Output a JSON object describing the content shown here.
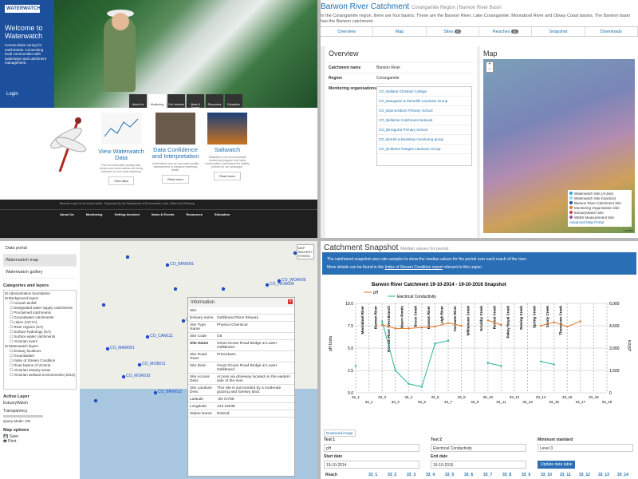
{
  "q1": {
    "logo": "WATERWATCH",
    "welcome": "Welcome to Waterwatch",
    "blurb": "Communities caring for catchments. Connecting local communities with waterways and catchment management.",
    "login": "Login",
    "nav": [
      "About Us",
      "Monitoring",
      "Get Involved",
      "News & Events",
      "Resources",
      "Education"
    ],
    "cards": [
      {
        "title": "View Waterwatch Data",
        "desc": "Find out what water quality data, photos and observations are being collected on your local waterway.",
        "btn": "View data"
      },
      {
        "title": "Data Confidence and Interpretation",
        "desc": "Understand how we use water quality assessments to measure waterway health.",
        "btn": "Read more"
      },
      {
        "title": "Saltwatch",
        "desc": "Saltwatch is an environmental monitoring program that helps communities understand the salinity problem in our landscape.",
        "btn": "Read more"
      }
    ],
    "footer_social": "Become a part of our social media",
    "footer_support": "Supported by the Department of Environment, Land, Water and Planning",
    "footer_cols": [
      "About Us",
      "Monitoring",
      "Getting Involved",
      "News & Events",
      "Resources",
      "Education"
    ]
  },
  "q2": {
    "title": "Barwon River Catchment",
    "subtitle": "Corangamite Region | Barwon River Basin",
    "desc": "In the Corangamite region, there are four basins. These are the Barwon River, Lake Corangamite, Moorabool River and Otway Coast basins. The Barwon basin has the Barwon catchment.",
    "tabs": [
      {
        "label": "Overview"
      },
      {
        "label": "Map"
      },
      {
        "label": "Sites",
        "badge": "93"
      },
      {
        "label": "Reaches",
        "badge": "36"
      },
      {
        "label": "Snapshot"
      },
      {
        "label": "Downloads"
      }
    ],
    "overview_heading": "Overview",
    "catchment_label": "Catchment name",
    "catchment_value": "Barwon River",
    "region_label": "Region",
    "region_value": "Corangamite",
    "orgs_label": "Monitoring organisations",
    "orgs": [
      "CO_Ballarat Christian College",
      "CO_Bamganie & Meredith Landcare Group",
      "CO_Bannockburn Primary School",
      "CO_Bellarine Catchment Network",
      "CO_Birregurra Primary School",
      "CO_Borrell-a-kandelop monitoring group",
      "CO_Brisbane Ranges Landcare Group"
    ],
    "map_heading": "Map",
    "legend": [
      {
        "label": "Waterwatch Site (Active)",
        "color": "#2aa5d8"
      },
      {
        "label": "Waterwatch Site (Inactive)",
        "color": "#9ad3ea"
      },
      {
        "label": "Barwon River Catchment Site",
        "color": "#1c4f9c"
      },
      {
        "label": "Monitoring Organisation Site",
        "color": "#e07a2a"
      },
      {
        "label": "EstuaryWatch Site",
        "color": "#d63c3c"
      },
      {
        "label": "WMIS Measurement Site",
        "color": "#a04fa0"
      },
      {
        "label": "Advanced Map Portal",
        "color": ""
      }
    ],
    "leaflet": "Leaflet"
  },
  "q3": {
    "menu": [
      "Data portal",
      "Waterwatch map",
      "Waterwatch gallery"
    ],
    "layers_heading": "Categories and layers",
    "layers": [
      "Administration boundaries",
      "Background layers",
      "Annual rainfall",
      "Designated water supply catchments",
      "Proclaimed catchments",
      "Groundwater catchments",
      "Lakes (VICTA)",
      "River regions (SA)",
      "Surface hydrology (SA)",
      "Surface water catchments",
      "Victorian rivers",
      "Waterwatch layers",
      "Estuary locations",
      "Groundwater",
      "Index of Stream Condition",
      "River basins of Victoria",
      "Victorian estuary areas",
      "Victorian wetland environments (2013)"
    ],
    "active_heading": "Active Layer",
    "active_value": "EstuaryWatch",
    "transparency": "Transparency",
    "query": "Query Mode: ON",
    "map_options": "Map options",
    "save": "Save",
    "print": "Print",
    "map_types": [
      "MAP",
      "IMAGERY",
      "HYBRID"
    ],
    "site_labels": [
      "CO_BRW001",
      "CO_WOA006",
      "CO_WOA005",
      "CO_CAM111",
      "CO_MAW001",
      "CO_MOB011",
      "CO_MOR010",
      "CO_SCC005",
      "CO_BRW012",
      "CO_RED001"
    ],
    "info_title": "Information",
    "info": [
      [
        "Site",
        ""
      ],
      [
        "Estuary name",
        "Gellibrand River Estuary"
      ],
      [
        "Site Type Name",
        "Physico-Chemical"
      ],
      [
        "Site Code",
        "G6"
      ],
      [
        "Site Name",
        "Great Ocean Road Bridge at Lower Gellibrand"
      ],
      [
        "Site Road Town",
        "Princetown"
      ],
      [
        "Site Desc",
        "Great Ocean Road Bridge at Lower Gellibrand"
      ],
      [
        "Site Access Desc",
        "Access via driveway located on the eastern side of the river."
      ],
      [
        "Site Landuse Desc",
        "This site is surrounded by a moderate grazing and forestry land."
      ],
      [
        "Latitude",
        "-38.72758"
      ],
      [
        "Longitude",
        "143.15038"
      ],
      [
        "Status Name",
        "Retired"
      ]
    ]
  },
  "q4": {
    "title": "Catchment Snapshot",
    "subtitle": "Median values for period",
    "banner1": "The catchment snapshot uses site samples to show the median values for the period over each reach of the river.",
    "banner2_pre": "More details can be found in the",
    "banner2_link": "Index of Stream Condition report",
    "banner2_post": "relevant to this region",
    "download": "Download image",
    "test1_label": "Test 1",
    "test1_value": "pH",
    "test2_label": "Test 2",
    "test2_value": "Electrical Conductivity",
    "min_label": "Minimum standard",
    "min_value": "Level 3",
    "start_label": "Start date",
    "start_value": "19-10-2014",
    "end_label": "End date",
    "end_value": "19-10-2016",
    "update": "Update data table",
    "reach_label": "Reach",
    "reach_values": [
      "33_1",
      "33_2",
      "33_3",
      "33_4",
      "33_5",
      "33_6",
      "33_7",
      "33_8",
      "33_9",
      "33_10",
      "33_11",
      "33_12",
      "33_13",
      "33_14"
    ]
  },
  "chart_data": {
    "type": "line",
    "title": "Barwon River Catchment 19-10-2014 - 19-10-2016 Snapshot",
    "ylabel": "pH Units",
    "y2label": "µS/cm",
    "ylim": [
      0,
      10
    ],
    "y2lim": [
      0,
      6000
    ],
    "yticks": [
      "0.0",
      "2.5",
      "5.0",
      "7.5",
      "10.0"
    ],
    "y2ticks": [
      "0",
      "1,500",
      "3,000",
      "4,500",
      "6,000"
    ],
    "categories": [
      "32_1",
      "33_1",
      "33_2",
      "33_3",
      "33_4",
      "33_5",
      "33_6",
      "33_7",
      "33_8",
      "33_9",
      "33_10",
      "33_11",
      "33_12",
      "33_13",
      "33_14",
      "33_15",
      "33_16",
      "33_17",
      "33_18",
      "33_19"
    ],
    "xlabels_top": [
      "32_1",
      "33_2",
      "33_4",
      "33_6",
      "33_8",
      "33_10",
      "33_12",
      "33_14",
      "33_16",
      "33_18"
    ],
    "xlabels_bottom": [
      "33_1",
      "33_3",
      "33_5",
      "33_7",
      "33_9",
      "33_11",
      "33_13",
      "33_15",
      "33_17",
      "33_19"
    ],
    "reach_names": [
      "Moorabool River",
      "Barwon River",
      "Barwon River West Branch",
      "Waurn Ponds",
      "Bruce Creek",
      "Barwon River",
      "Leigh River",
      "Yarrowee River",
      "Williamson Creek",
      "Scrubby Creek",
      "Retreat Creek",
      "Pokey Royal Creek",
      "Dewing Creek",
      "Spring Creek",
      "Sandy Creek",
      "Thompson Creek"
    ],
    "series": [
      {
        "name": "pH",
        "color": "#e07a2a",
        "points": [
          [
            2,
            7.6
          ],
          [
            3,
            7.2
          ],
          [
            4,
            7.2
          ],
          [
            5,
            7.3
          ],
          [
            6,
            7.4
          ],
          [
            7,
            7.8
          ],
          [
            8,
            7.5
          ],
          [
            10,
            8.1
          ],
          [
            11,
            7.6
          ],
          [
            14,
            7.5
          ],
          [
            15,
            7.9
          ],
          [
            16,
            7.4
          ],
          [
            17,
            8.0
          ]
        ]
      },
      {
        "name": "Electrical Conductivity",
        "color": "#2bb39b",
        "points": [
          [
            0,
            1800
          ],
          [
            2,
            4800
          ],
          [
            3,
            1500
          ],
          [
            4,
            600
          ],
          [
            5,
            400
          ],
          [
            6,
            3300
          ],
          [
            7,
            3500
          ],
          [
            10,
            2000
          ],
          [
            11,
            1800
          ],
          [
            14,
            2100
          ],
          [
            15,
            1900
          ]
        ]
      }
    ]
  }
}
